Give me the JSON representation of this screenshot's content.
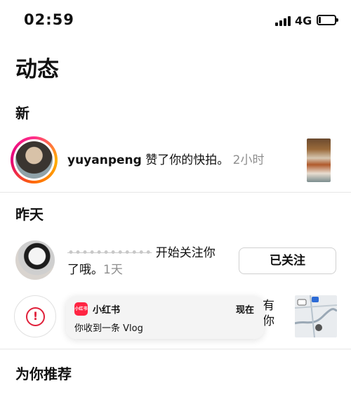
{
  "status_bar": {
    "time": "02:59",
    "network": "4G",
    "battery_level": 0.15
  },
  "page_title": "动态",
  "sections": {
    "new": "新",
    "yesterday": "昨天",
    "recommended": "为你推荐"
  },
  "new_item": {
    "username": "yuyanpeng",
    "action": " 赞了你的快拍。",
    "time": "2小时"
  },
  "follow_item": {
    "line1_partial": "开始关注你",
    "line2": "了哦。",
    "time": "1天",
    "button": "已关注"
  },
  "hidden_item": {
    "line1_partial": "有",
    "line2_partial": "你"
  },
  "notification": {
    "app_icon_text": "小红书",
    "app_name": "小红书",
    "time": "现在",
    "body": "你收到一条 Vlog"
  },
  "colors": {
    "accent_red": "#e0203a",
    "ring_start": "#ff2d8a",
    "ring_end": "#ffb000"
  }
}
